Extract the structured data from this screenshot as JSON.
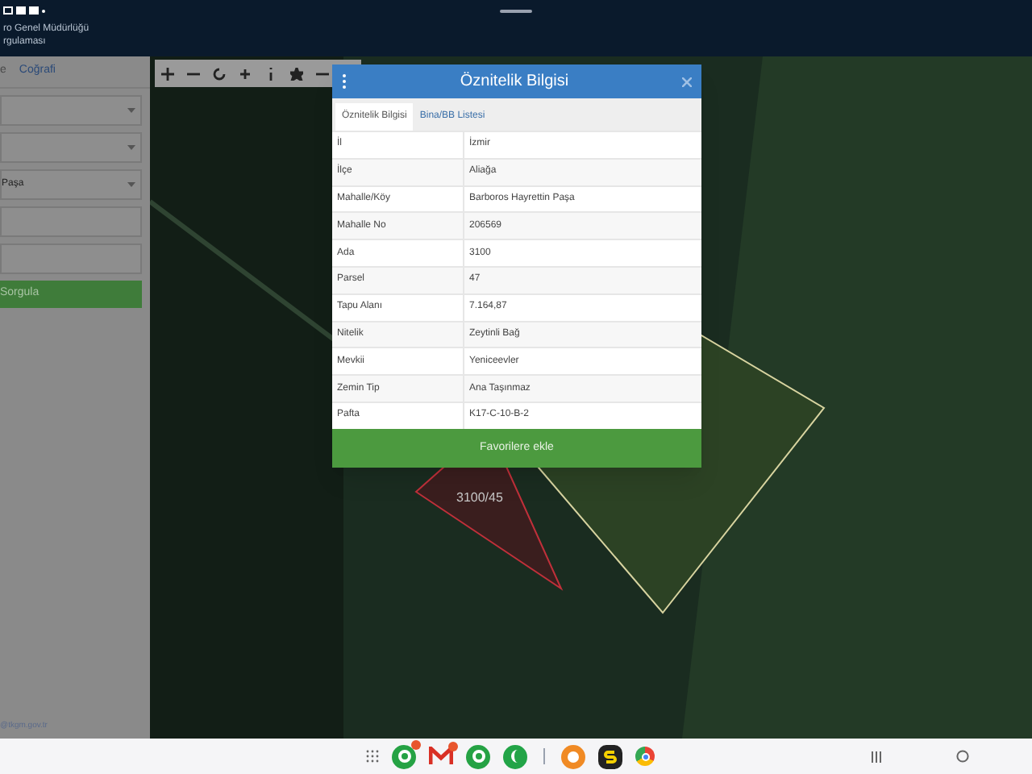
{
  "header": {
    "title_line1": "ro Genel Müdürlüğü",
    "title_line2": "rgulaması"
  },
  "sidebar": {
    "tabs": [
      {
        "label": "e",
        "selected": false
      },
      {
        "label": "Coğrafi",
        "selected": true
      }
    ],
    "fields": [
      {
        "kind": "select"
      },
      {
        "kind": "select"
      },
      {
        "kind": "select",
        "value": "Paşa"
      },
      {
        "kind": "input"
      },
      {
        "kind": "input"
      }
    ],
    "button": "Sorgula",
    "footer": "@tkgm.gov.tr"
  },
  "map": {
    "parcel_label": "3100/45"
  },
  "dialog": {
    "title": "Öznitelik Bilgisi",
    "tabs": [
      {
        "label": "Öznitelik Bilgisi",
        "selected": true
      },
      {
        "label": "Bina/BB Listesi",
        "selected": false
      }
    ],
    "rows": [
      {
        "key": "İl",
        "value": "İzmir"
      },
      {
        "key": "İlçe",
        "value": "Aliağa"
      },
      {
        "key": "Mahalle/Köy",
        "value": "Barboros Hayrettin Paşa"
      },
      {
        "key": "Mahalle No",
        "value": "206569"
      },
      {
        "key": "Ada",
        "value": "3100"
      },
      {
        "key": "Parsel",
        "value": "47"
      },
      {
        "key": "Tapu Alanı",
        "value": "7.164,87"
      },
      {
        "key": "Nitelik",
        "value": "Zeytinli Bağ"
      },
      {
        "key": "Mevkii",
        "value": "Yeniceevler"
      },
      {
        "key": "Zemin Tip",
        "value": "Ana Taşınmaz"
      },
      {
        "key": "Pafta",
        "value": "K17-C-10-B-2"
      }
    ],
    "button": "Favorilere ekle"
  },
  "taskbar": {
    "apps": [
      {
        "kind": "whatsapp",
        "badge": true
      },
      {
        "kind": "mail",
        "badge": true
      },
      {
        "kind": "whatsapp",
        "badge": false
      },
      {
        "kind": "phone",
        "badge": false
      },
      {
        "kind": "divider",
        "badge": false
      },
      {
        "kind": "orange",
        "badge": false
      },
      {
        "kind": "s",
        "badge": false
      },
      {
        "kind": "browser",
        "badge": false
      }
    ]
  }
}
